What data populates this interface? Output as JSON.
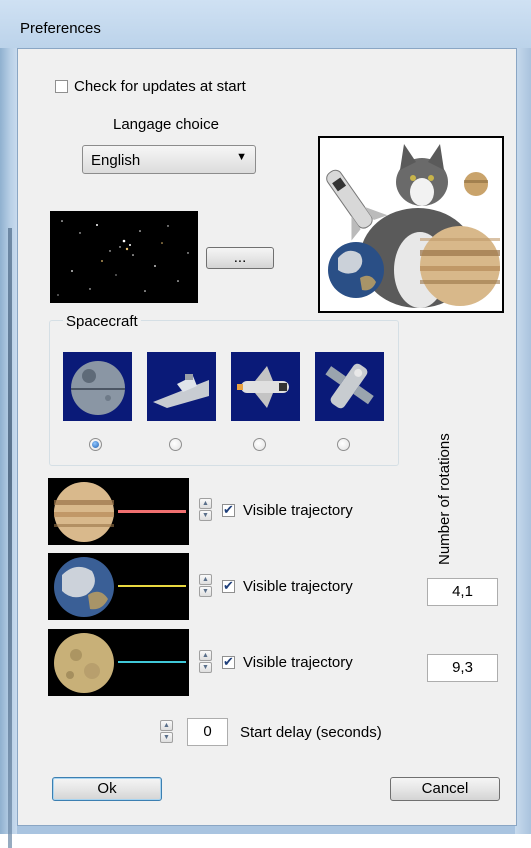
{
  "window": {
    "title": "Preferences"
  },
  "updates": {
    "label": "Check for updates at start",
    "checked": false
  },
  "language": {
    "label": "Langage choice",
    "selected": "English"
  },
  "background": {
    "browse_label": "..."
  },
  "spacecraft": {
    "label": "Spacecraft",
    "options": [
      {
        "icon": "death-star-icon",
        "selected": true
      },
      {
        "icon": "star-destroyer-icon",
        "selected": false
      },
      {
        "icon": "space-shuttle-icon",
        "selected": false
      },
      {
        "icon": "satellite-icon",
        "selected": false
      }
    ]
  },
  "rotations": {
    "label": "Number of rotations"
  },
  "planets": [
    {
      "icon": "jupiter-icon",
      "trajectory_label": "Visible trajectory",
      "visible": true,
      "rotations": "",
      "line_color": "#f07070"
    },
    {
      "icon": "earth-icon",
      "trajectory_label": "Visible trajectory",
      "visible": true,
      "rotations": "4,1",
      "line_color": "#e8d840"
    },
    {
      "icon": "moon-icon",
      "trajectory_label": "Visible trajectory",
      "visible": true,
      "rotations": "9,3",
      "line_color": "#40c8d8"
    }
  ],
  "start_delay": {
    "value": "0",
    "label": "Start delay (seconds)"
  },
  "buttons": {
    "ok": "Ok",
    "cancel": "Cancel"
  }
}
